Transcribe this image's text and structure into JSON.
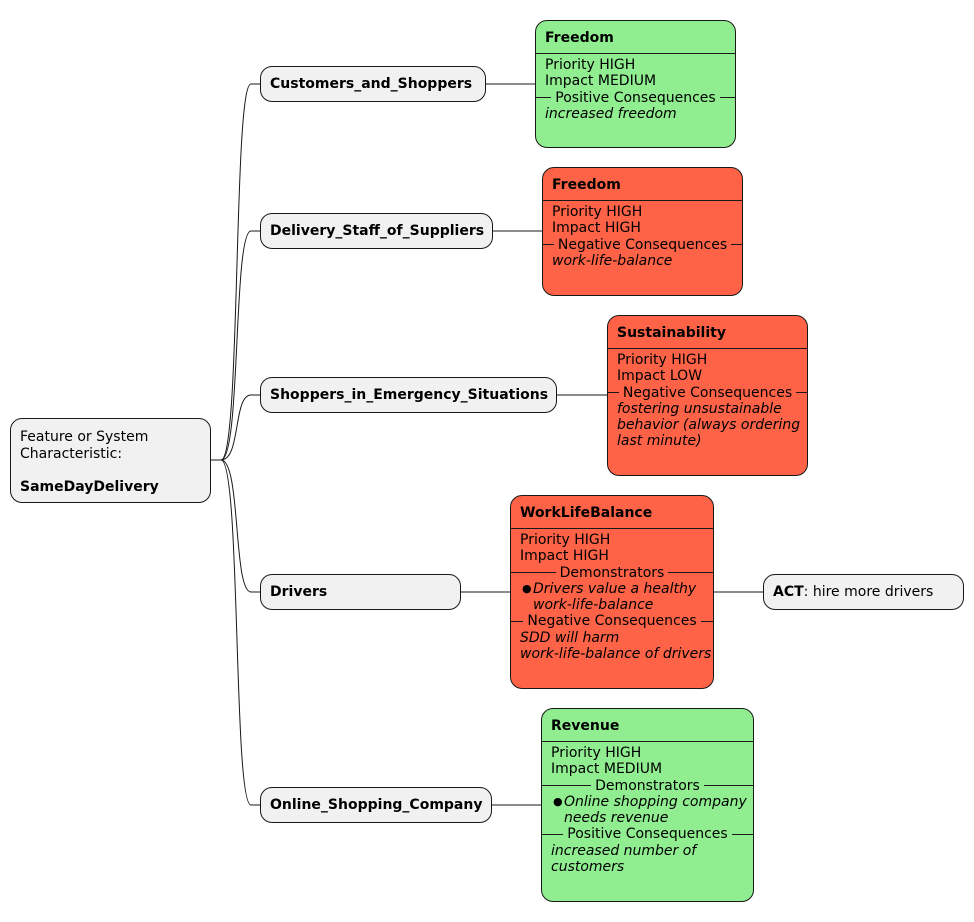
{
  "root": {
    "line1": "Feature or System",
    "line2": "Characteristic:",
    "name": "SameDayDelivery"
  },
  "colors": {
    "positive": "#90ee90",
    "negative": "#ff6347",
    "neutral": "#f1f1f1",
    "line": "#181818"
  },
  "stakeholders": [
    {
      "name": "Customers_and_Shoppers",
      "value": {
        "title": "Freedom",
        "tone": "positive",
        "priority": "Priority HIGH",
        "impact": "Impact MEDIUM",
        "sections": [
          {
            "heading": "Positive Consequences",
            "lines": [
              "increased freedom"
            ],
            "bullets": []
          }
        ]
      }
    },
    {
      "name": "Delivery_Staff_of_Suppliers",
      "value": {
        "title": "Freedom",
        "tone": "negative",
        "priority": "Priority HIGH",
        "impact": "Impact HIGH",
        "sections": [
          {
            "heading": "Negative Consequences",
            "lines": [
              "work-life-balance"
            ],
            "bullets": []
          }
        ]
      }
    },
    {
      "name": "Shoppers_in_Emergency_Situations",
      "value": {
        "title": "Sustainability",
        "tone": "negative",
        "priority": "Priority HIGH",
        "impact": "Impact LOW",
        "sections": [
          {
            "heading": "Negative Consequences",
            "lines": [
              "fostering unsustainable",
              "behavior (always ordering",
              "last minute)"
            ],
            "bullets": []
          }
        ]
      }
    },
    {
      "name": "Drivers",
      "value": {
        "title": "WorkLifeBalance",
        "tone": "negative",
        "priority": "Priority HIGH",
        "impact": "Impact HIGH",
        "sections": [
          {
            "heading": "Demonstrators",
            "lines": [],
            "bullets": [
              [
                "Drivers value a healthy",
                "work-life-balance"
              ]
            ]
          },
          {
            "heading": "Negative Consequences",
            "lines": [
              "SDD will harm",
              "work-life-balance of drivers"
            ],
            "bullets": []
          }
        ]
      },
      "action": {
        "label": "ACT",
        "text": ": hire more drivers"
      }
    },
    {
      "name": "Online_Shopping_Company",
      "value": {
        "title": "Revenue",
        "tone": "positive",
        "priority": "Priority HIGH",
        "impact": "Impact MEDIUM",
        "sections": [
          {
            "heading": "Demonstrators",
            "lines": [],
            "bullets": [
              [
                "Online shopping company",
                "needs revenue"
              ]
            ]
          },
          {
            "heading": "Positive Consequences",
            "lines": [
              "increased number of",
              "customers"
            ],
            "bullets": []
          }
        ]
      }
    }
  ]
}
